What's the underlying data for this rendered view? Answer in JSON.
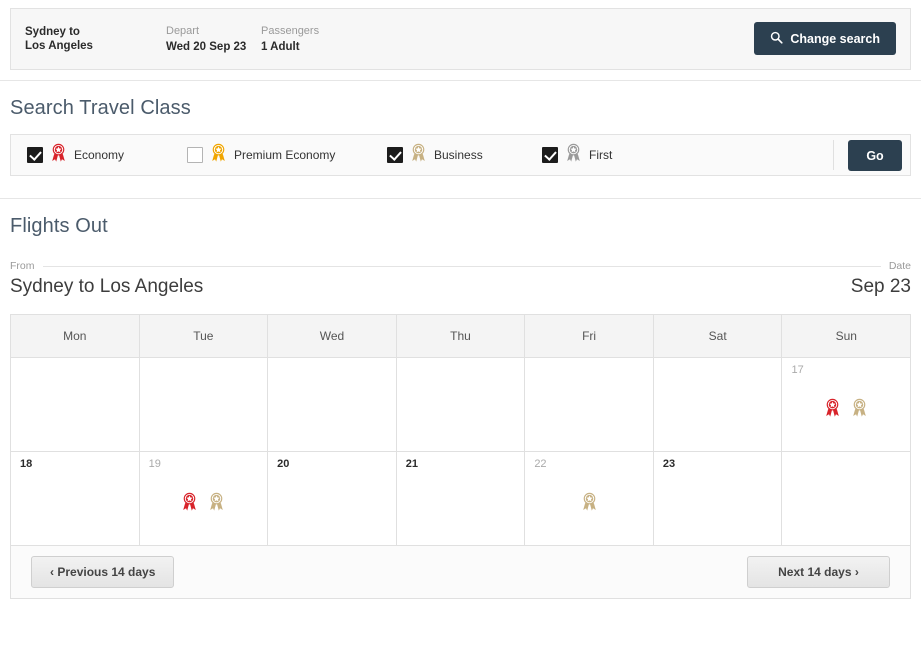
{
  "summary": {
    "route_label": "Sydney  to",
    "route_value": "Los Angeles",
    "depart_label": "Depart",
    "depart_value": "Wed 20 Sep 23",
    "passengers_label": "Passengers",
    "passengers_value": "1 Adult",
    "change_search_label": "Change search",
    "search_icon": "search-icon"
  },
  "travel_class": {
    "title": "Search Travel Class",
    "go_label": "Go",
    "options": [
      {
        "label": "Economy",
        "checked": true,
        "icon": "rosette-icon",
        "color": "#d8232a"
      },
      {
        "label": "Premium Economy",
        "checked": false,
        "icon": "rosette-icon",
        "color": "#f0a500"
      },
      {
        "label": "Business",
        "checked": true,
        "icon": "rosette-icon",
        "color": "#c7b183"
      },
      {
        "label": "First",
        "checked": true,
        "icon": "rosette-icon",
        "color": "#9a9a9a"
      }
    ]
  },
  "flights_out": {
    "title": "Flights Out",
    "from_label": "From",
    "date_label": "Date",
    "route": "Sydney to Los Angeles",
    "date": "Sep 23"
  },
  "calendar": {
    "day_headers": [
      "Mon",
      "Tue",
      "Wed",
      "Thu",
      "Fri",
      "Sat",
      "Sun"
    ],
    "rows": [
      [
        {
          "day": "",
          "available": false,
          "icons": []
        },
        {
          "day": "",
          "available": false,
          "icons": []
        },
        {
          "day": "",
          "available": false,
          "icons": []
        },
        {
          "day": "",
          "available": false,
          "icons": []
        },
        {
          "day": "",
          "available": false,
          "icons": []
        },
        {
          "day": "",
          "available": false,
          "icons": []
        },
        {
          "day": "17",
          "available": false,
          "icons": [
            "#d8232a",
            "#c7b183"
          ]
        }
      ],
      [
        {
          "day": "18",
          "available": true,
          "icons": []
        },
        {
          "day": "19",
          "available": false,
          "icons": [
            "#d8232a",
            "#c7b183"
          ]
        },
        {
          "day": "20",
          "available": true,
          "icons": []
        },
        {
          "day": "21",
          "available": true,
          "icons": []
        },
        {
          "day": "22",
          "available": false,
          "icons": [
            "#c7b183"
          ]
        },
        {
          "day": "23",
          "available": true,
          "icons": []
        },
        {
          "day": "",
          "available": false,
          "icons": []
        }
      ]
    ],
    "prev_label": "Previous 14 days",
    "next_label": "Next 14 days",
    "prev_chevron": "chevron-left-icon",
    "next_chevron": "chevron-right-icon"
  }
}
